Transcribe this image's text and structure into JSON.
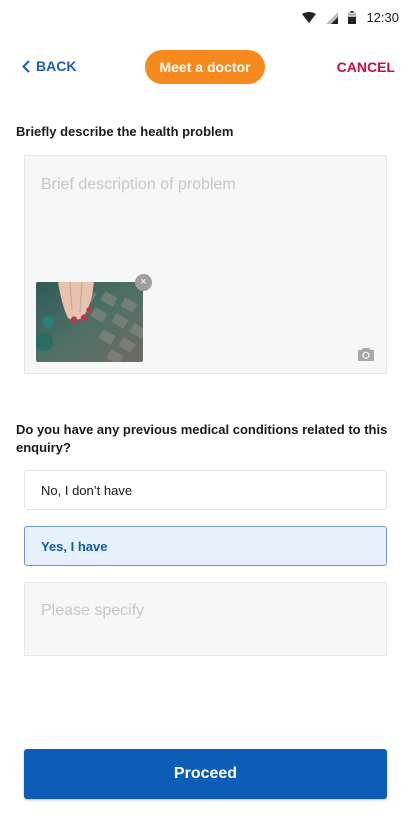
{
  "status_bar": {
    "time": "12:30",
    "icons": [
      "wifi-icon",
      "signal-icon",
      "battery-icon"
    ]
  },
  "header": {
    "back_label": "BACK",
    "title": "Meet a doctor",
    "cancel_label": "CANCEL"
  },
  "form": {
    "question_1": "Briefly describe the health problem",
    "description_placeholder": "Brief description of problem",
    "attachment_close": "×",
    "question_2": "Do you have any previous medical conditions related to this enquiry?",
    "options": [
      {
        "label": "No, I don’t have",
        "selected": false
      },
      {
        "label": "Yes, I have",
        "selected": true
      }
    ],
    "specify_placeholder": "Please specify"
  },
  "footer": {
    "proceed_label": "Proceed"
  },
  "colors": {
    "accent_orange": "#f78a1f",
    "primary_blue": "#0b5db5",
    "cancel_red": "#c4113d",
    "selected_bg": "#e7f1fb"
  }
}
